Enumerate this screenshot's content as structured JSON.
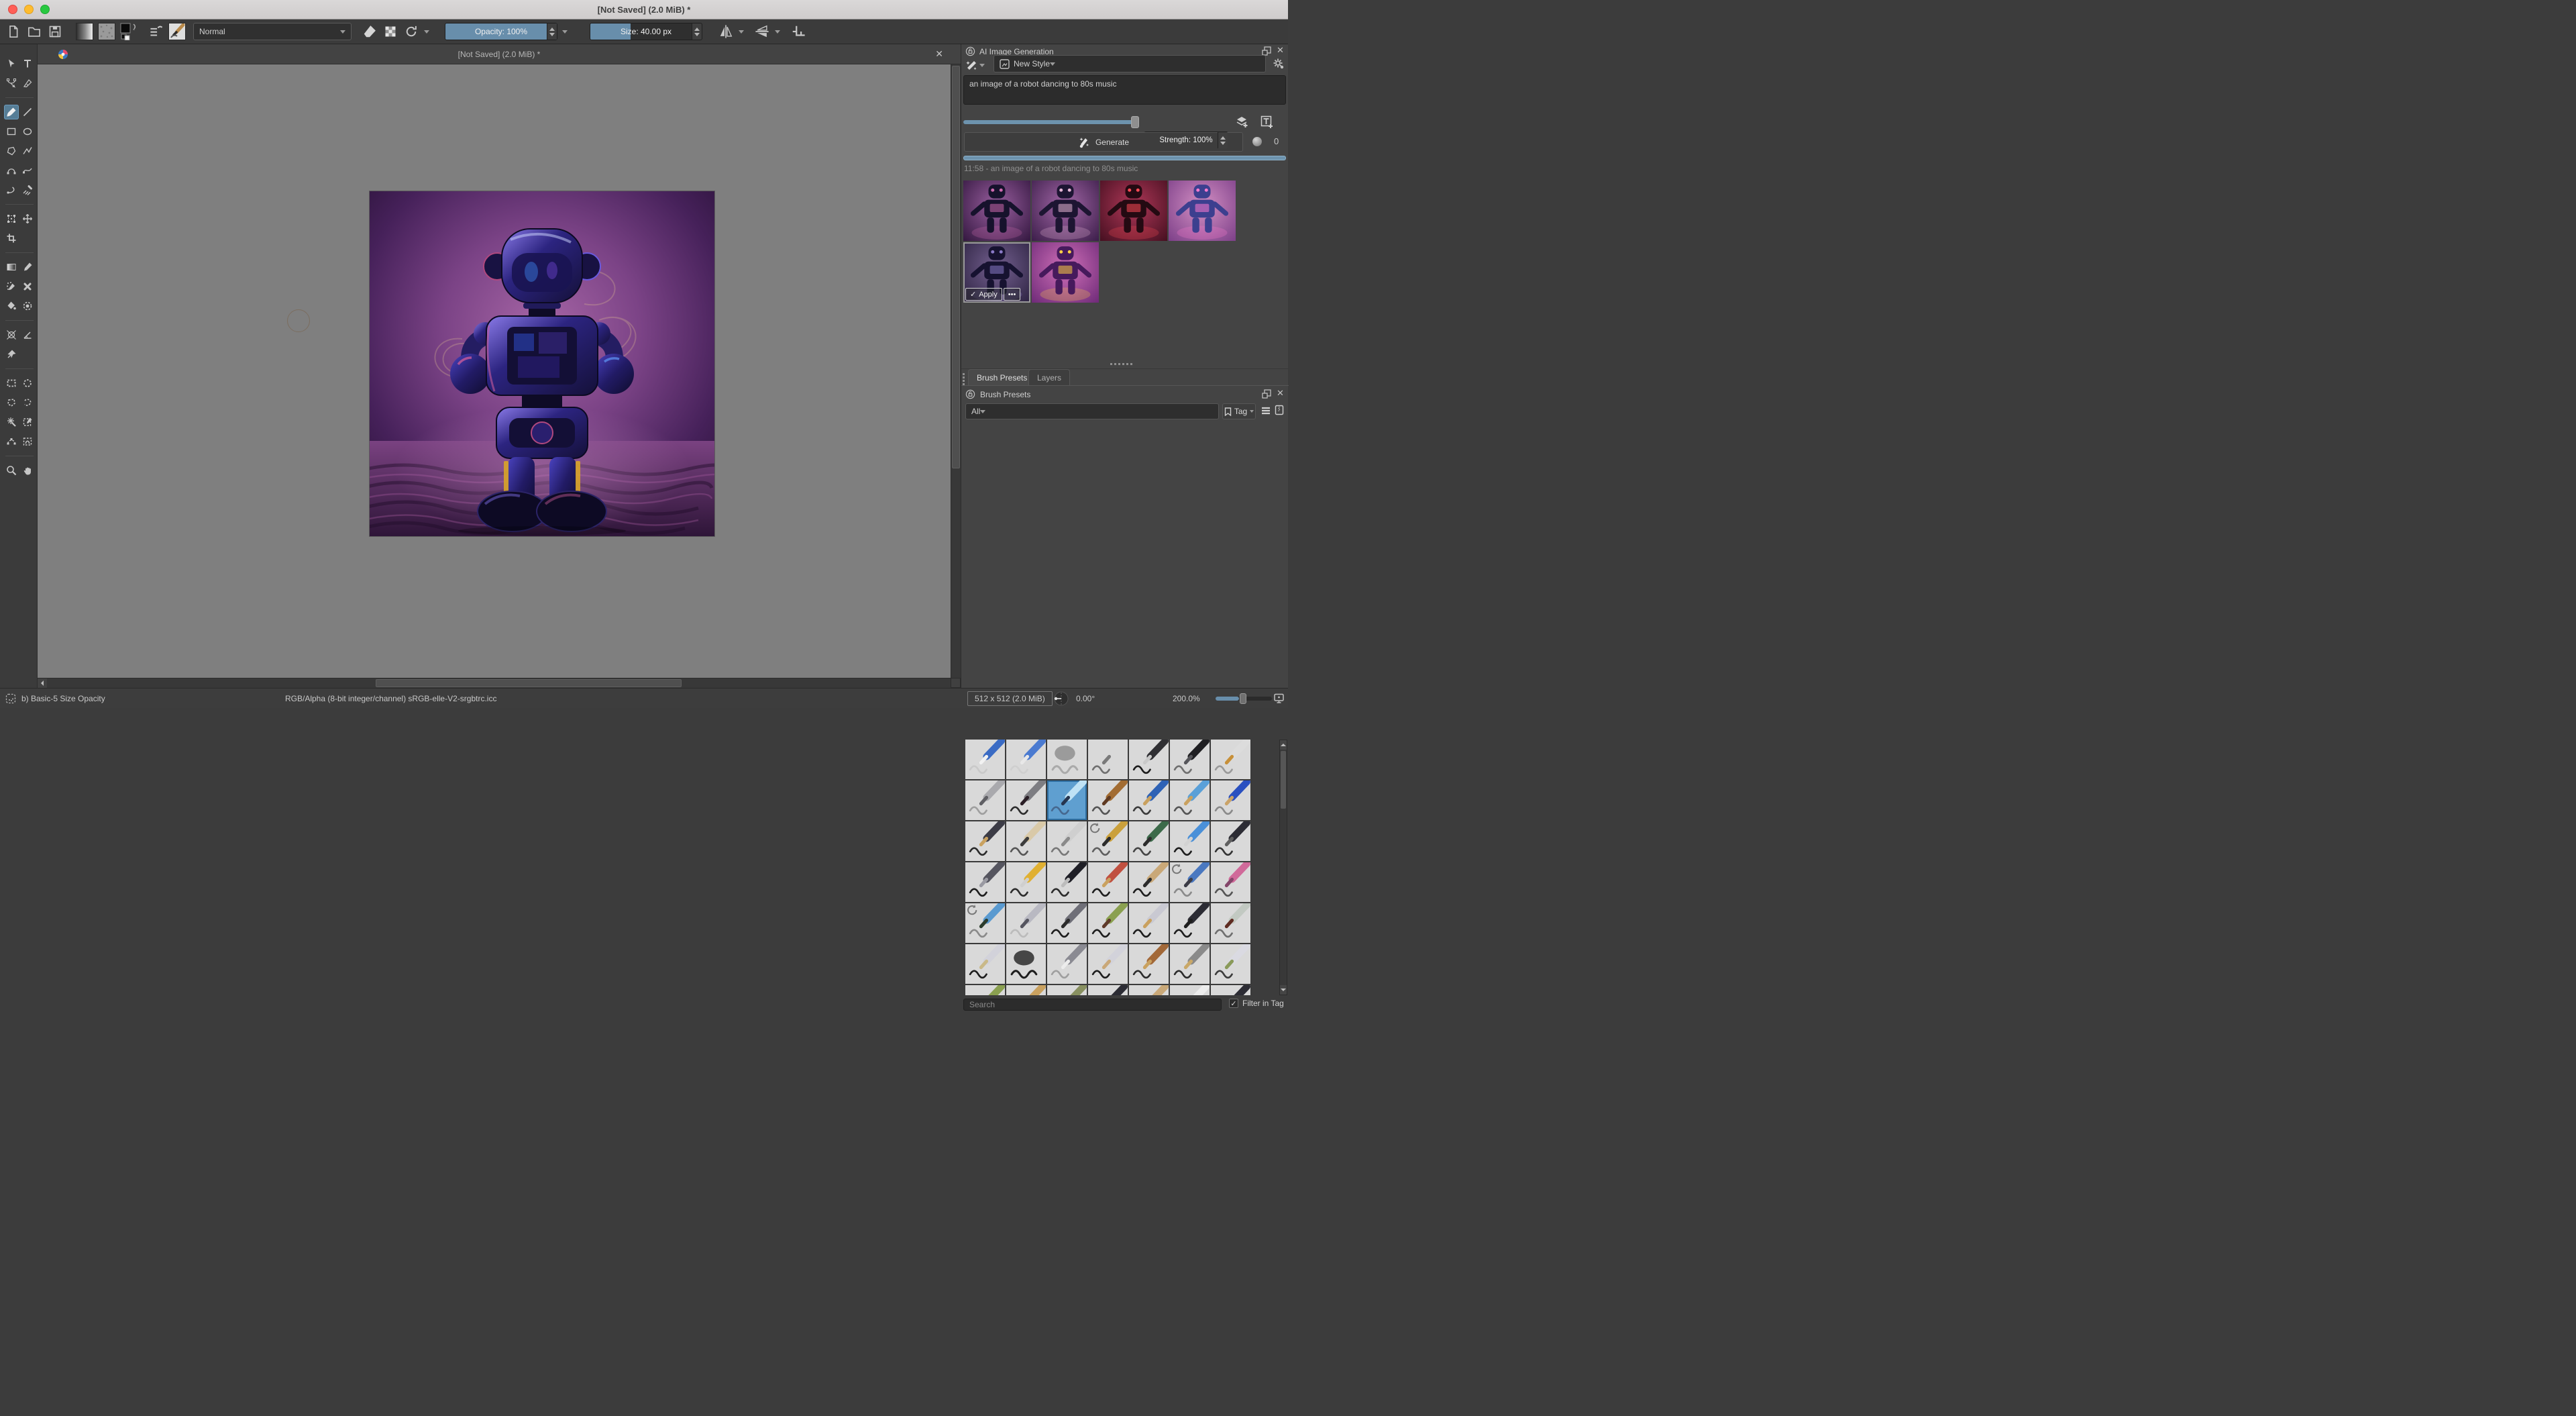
{
  "window": {
    "title": "[Not Saved]  (2.0 MiB) *"
  },
  "toolbar": {
    "blend_mode": "Normal",
    "opacity": "Opacity: 100%",
    "size": "Size: 40.00 px"
  },
  "toolbox": {
    "active_tool": "freehand-brush",
    "tools": [
      "select-shapes",
      "text",
      "edit-shapes",
      "calligraphy",
      "freehand-brush",
      "line",
      "rectangle",
      "ellipse",
      "polygon",
      "polyline",
      "bezier-curve",
      "freehand-path",
      "dynamic-brush",
      "multibrush",
      "transform",
      "move",
      "crop",
      "gradient",
      "color-sampler",
      "smart-patch",
      "colorize-mask",
      "fill",
      "enclose-fill",
      "assistants",
      "measure",
      "reference-images",
      "rect-select",
      "ellipse-select",
      "polygon-select",
      "freehand-select",
      "similar-select",
      "color-select",
      "bezier-select",
      "magnetic-select",
      "zoom",
      "pan"
    ]
  },
  "canvas": {
    "tab_title": "[Not Saved]  (2.0 MiB) *"
  },
  "ai_panel": {
    "title": "AI Image Generation",
    "style": "New Style",
    "prompt": "an image of a robot dancing to 80s music",
    "strength": "Strength: 100%",
    "generate": "Generate",
    "queue_count": "0",
    "history": "11:58 - an image of a robot dancing to 80s music",
    "apply": "Apply",
    "more": "•••",
    "thumbnails": [
      {
        "c1": "#9a5fa0",
        "c2": "#33173f",
        "robot": "#16122c",
        "accent": "#d06ab0"
      },
      {
        "c1": "#a468a8",
        "c2": "#3b1d49",
        "robot": "#1d1532",
        "accent": "#e6b6d6"
      },
      {
        "c1": "#b03858",
        "c2": "#450f20",
        "robot": "#240a12",
        "accent": "#ff4a55"
      },
      {
        "c1": "#d490c4",
        "c2": "#7c3f88",
        "robot": "#3c3f8f",
        "accent": "#ff7ad0"
      },
      {
        "c1": "#746090",
        "c2": "#2c2240",
        "robot": "#161230",
        "accent": "#8a7ac8",
        "selected": true
      },
      {
        "c1": "#d070b8",
        "c2": "#6e2a78",
        "robot": "#461a5c",
        "accent": "#ffd044"
      }
    ]
  },
  "brush_docker": {
    "tabs": [
      "Brush Presets",
      "Layers"
    ],
    "title": "Brush Presets",
    "tag_filter": "All",
    "tag": "Tag",
    "search_placeholder": "Search",
    "filter_in_tag": "Filter in Tag",
    "filter_checked": true,
    "tiles": [
      {
        "b": "#3a6bc4",
        "t": "#f2f2f2",
        "s": "#c9c9c9"
      },
      {
        "b": "#4a7ad0",
        "t": "#e8e8e8",
        "s": "#cfcfcf"
      },
      {
        "soft": 1,
        "b": "#8f8f8f",
        "s": "#aaaaaa"
      },
      {
        "b": "#d9d9d9",
        "t": "#7a7a7a",
        "s": "#6f6f6f"
      },
      {
        "b": "#2f2f33",
        "t": "#c9c9c9",
        "s": "#1d1d1d"
      },
      {
        "b": "#1f1f22",
        "t": "#55555a",
        "s": "#707070"
      },
      {
        "b": "#dcdcdc",
        "t": "#c79039",
        "s": "#9a9a9a"
      },
      {
        "b": "#a9a9ad",
        "t": "#5f5f64",
        "s": "#9f9f9f"
      },
      {
        "b": "#7d7d82",
        "t": "#2a1e26",
        "s": "#2c2c2c"
      },
      {
        "sel": 1,
        "b": "#bfe2f5",
        "t": "#26354f",
        "s": "#46688f"
      },
      {
        "b": "#a26c32",
        "t": "#5f3a22",
        "s": "#555555"
      },
      {
        "b": "#2e62b5",
        "t": "#c9a15f",
        "s": "#3a3a3a"
      },
      {
        "b": "#5aa0d8",
        "t": "#c9a15f",
        "s": "#555555"
      },
      {
        "b": "#2a50c0",
        "t": "#caa368",
        "s": "#8a8a8a"
      },
      {
        "b": "#3c3c46",
        "t": "#c9a15f",
        "s": "#2a2a2a"
      },
      {
        "b": "#d9c9a8",
        "t": "#3c3c3c",
        "s": "#555555"
      },
      {
        "b": "#cfcfcf",
        "t": "#8a8a8a",
        "s": "#777777"
      },
      {
        "b": "#caa03c",
        "t": "#2c2c2c",
        "s": "#5f5f5f",
        "badge": 1
      },
      {
        "b": "#3c6a4a",
        "t": "#2c2c2c",
        "s": "#444444"
      },
      {
        "b": "#4a90d8",
        "t": "#d2d2d2",
        "s": "#1d1d1d"
      },
      {
        "b": "#2c2c34",
        "t": "#5f5f5f",
        "s": "#333333"
      },
      {
        "b": "#55555f",
        "t": "#9a9aa2",
        "s": "#1d1d1d"
      },
      {
        "b": "#e0b032",
        "t": "#cfcfcf",
        "s": "#2c2c2c"
      },
      {
        "b": "#1f1f26",
        "t": "#bcbcbc",
        "s": "#2c2c2c"
      },
      {
        "b": "#c05040",
        "t": "#c9a15f",
        "s": "#1d1d1d"
      },
      {
        "b": "#c9a878",
        "t": "#2c2c2c",
        "s": "#1d1d1d"
      },
      {
        "b": "#4a78c0",
        "t": "#3c3c46",
        "s": "#8a8a8a",
        "badge": 1
      },
      {
        "b": "#d06a9a",
        "t": "#84466a",
        "s": "#555555"
      },
      {
        "b": "#5a9ad0",
        "t": "#2c3c2c",
        "s": "#8a8a8a",
        "badge": 1
      },
      {
        "b": "#b9b9c2",
        "t": "#55555f",
        "s": "#bbbbbb"
      },
      {
        "b": "#6f6f78",
        "t": "#2c2c2c",
        "s": "#1d1d1d"
      },
      {
        "b": "#8aa050",
        "t": "#5f3a2a",
        "s": "#1d1d1d"
      },
      {
        "b": "#c9c9d2",
        "t": "#c9a15f",
        "s": "#1d1d1d"
      },
      {
        "b": "#2c2c34",
        "t": "#1d1d1d",
        "s": "#1d1d1d"
      },
      {
        "b": "#c2c9c2",
        "t": "#5f2c22",
        "s": "#6f6f6f"
      },
      {
        "b": "#d2d2da",
        "t": "#c9b988",
        "s": "#1d1d1d"
      },
      {
        "soft": 1,
        "b": "#2c2c2c",
        "s": "#1d1d1d"
      },
      {
        "b": "#8a8a92",
        "t": "#ececec",
        "s": "#9f9f9f"
      },
      {
        "b": "#d2d2da",
        "t": "#c9a878",
        "s": "#1d1d1d"
      },
      {
        "b": "#a26838",
        "t": "#c9a15f",
        "s": "#2c2c2c"
      },
      {
        "b": "#8a8a8a",
        "t": "#c9a868",
        "s": "#2c2c2c"
      },
      {
        "b": "#dadae2",
        "t": "#8a9a5a",
        "s": "#3c3c3c"
      },
      {
        "b": "#8aa050"
      },
      {
        "b": "#c9a15f"
      },
      {
        "b": "#889060"
      },
      {
        "b": "#2c2c34"
      },
      {
        "b": "#c9a878"
      },
      {
        "b": "#ececec"
      },
      {
        "b": "#2c2c34"
      }
    ]
  },
  "status": {
    "brush": "b) Basic-5 Size Opacity",
    "colorspace": "RGB/Alpha (8-bit integer/channel)  sRGB-elle-V2-srgbtrc.icc",
    "size": "512 x 512 (2.0 MiB)",
    "angle": "0.00°",
    "zoom": "200.0%"
  },
  "colors": {
    "accent": "#688eab",
    "selection": "#5f9fd0",
    "progress": "#6d93ae",
    "canvas": "#7f7f7f",
    "panel": "#444444",
    "toolbar": "#3b3b3b",
    "input": "#2c2c2c",
    "border": "#5a5a5a",
    "text": "#d2d2d2",
    "dim": "#9a9a9a",
    "mac_red": "#ff5f57",
    "mac_yellow": "#febc2e",
    "mac_green": "#28c840"
  }
}
